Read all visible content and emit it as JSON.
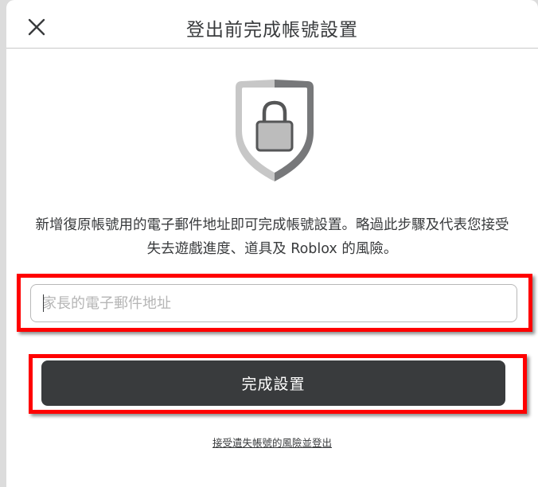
{
  "modal": {
    "title": "登出前完成帳號設置",
    "close_icon": "close-icon",
    "shield_icon": "shield-lock-icon",
    "description": "新增復原帳號用的電子郵件地址即可完成帳號設置。略過此步驟及代表您接受失去遊戲進度、道具及 Roblox 的風險。",
    "email_input": {
      "placeholder": "家長的電子郵件地址",
      "value": ""
    },
    "finish_button_label": "完成設置",
    "skip_link_label": "接受遺失帳號的風險並登出"
  },
  "colors": {
    "text": "#393b3d",
    "button_bg": "#393b3d",
    "highlight": "#ff0000",
    "shield_light": "#c7c7c7",
    "shield_dark": "#77787a"
  }
}
